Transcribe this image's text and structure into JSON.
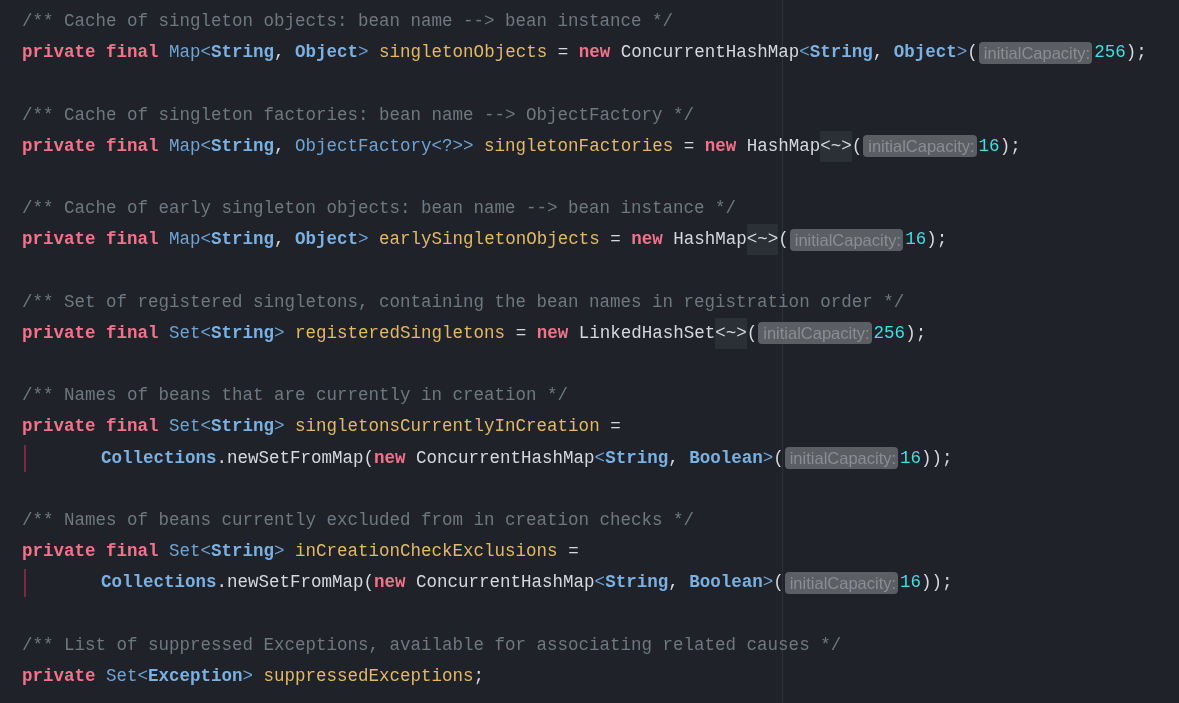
{
  "editor": {
    "lines": [
      {
        "kind": "comment",
        "text": "/** Cache of singleton objects: bean name --> bean instance */"
      },
      {
        "kind": "code",
        "continuation": false,
        "tokens": [
          {
            "kind": "keyword",
            "text": "private final "
          },
          {
            "kind": "type",
            "text": "Map<"
          },
          {
            "kind": "type_bold",
            "text": "String"
          },
          {
            "kind": "plain",
            "text": ", "
          },
          {
            "kind": "type_bold",
            "text": "Object"
          },
          {
            "kind": "type",
            "text": "> "
          },
          {
            "kind": "field",
            "text": "singletonObjects"
          },
          {
            "kind": "plain",
            "text": " = "
          },
          {
            "kind": "keyword",
            "text": "new "
          },
          {
            "kind": "plain",
            "text": "ConcurrentHashMap"
          },
          {
            "kind": "type",
            "text": "<"
          },
          {
            "kind": "type_bold",
            "text": "String"
          },
          {
            "kind": "plain",
            "text": ", "
          },
          {
            "kind": "type_bold",
            "text": "Object"
          },
          {
            "kind": "type",
            "text": ">"
          },
          {
            "kind": "plain",
            "text": "("
          },
          {
            "kind": "hint",
            "text": "initialCapacity:"
          },
          {
            "kind": "number",
            "text": "256"
          },
          {
            "kind": "plain",
            "text": ");"
          }
        ]
      },
      {
        "kind": "blank"
      },
      {
        "kind": "comment",
        "text": "/** Cache of singleton factories: bean name --> ObjectFactory */"
      },
      {
        "kind": "code",
        "continuation": false,
        "tokens": [
          {
            "kind": "keyword",
            "text": "private final "
          },
          {
            "kind": "type",
            "text": "Map<"
          },
          {
            "kind": "type_bold",
            "text": "String"
          },
          {
            "kind": "plain",
            "text": ", "
          },
          {
            "kind": "type",
            "text": "ObjectFactory<?>> "
          },
          {
            "kind": "field",
            "text": "singletonFactories"
          },
          {
            "kind": "plain",
            "text": " = "
          },
          {
            "kind": "keyword",
            "text": "new "
          },
          {
            "kind": "plain",
            "text": "HashMap"
          },
          {
            "kind": "fold",
            "text": "<~>"
          },
          {
            "kind": "plain",
            "text": "("
          },
          {
            "kind": "hint",
            "text": "initialCapacity:"
          },
          {
            "kind": "number",
            "text": "16"
          },
          {
            "kind": "plain",
            "text": ");"
          }
        ]
      },
      {
        "kind": "blank"
      },
      {
        "kind": "comment",
        "text": "/** Cache of early singleton objects: bean name --> bean instance */"
      },
      {
        "kind": "code",
        "continuation": false,
        "tokens": [
          {
            "kind": "keyword",
            "text": "private final "
          },
          {
            "kind": "type",
            "text": "Map<"
          },
          {
            "kind": "type_bold",
            "text": "String"
          },
          {
            "kind": "plain",
            "text": ", "
          },
          {
            "kind": "type_bold",
            "text": "Object"
          },
          {
            "kind": "type",
            "text": "> "
          },
          {
            "kind": "field",
            "text": "earlySingletonObjects"
          },
          {
            "kind": "plain",
            "text": " = "
          },
          {
            "kind": "keyword",
            "text": "new "
          },
          {
            "kind": "plain",
            "text": "HashMap"
          },
          {
            "kind": "fold",
            "text": "<~>"
          },
          {
            "kind": "plain",
            "text": "("
          },
          {
            "kind": "hint",
            "text": "initialCapacity:"
          },
          {
            "kind": "number",
            "text": "16"
          },
          {
            "kind": "plain",
            "text": ");"
          }
        ]
      },
      {
        "kind": "blank"
      },
      {
        "kind": "comment",
        "text": "/** Set of registered singletons, containing the bean names in registration order */"
      },
      {
        "kind": "code",
        "continuation": false,
        "tokens": [
          {
            "kind": "keyword",
            "text": "private final "
          },
          {
            "kind": "type",
            "text": "Set<"
          },
          {
            "kind": "type_bold",
            "text": "String"
          },
          {
            "kind": "type",
            "text": "> "
          },
          {
            "kind": "field",
            "text": "registeredSingletons"
          },
          {
            "kind": "plain",
            "text": " = "
          },
          {
            "kind": "keyword",
            "text": "new "
          },
          {
            "kind": "plain",
            "text": "LinkedHashSet"
          },
          {
            "kind": "fold",
            "text": "<~>"
          },
          {
            "kind": "plain",
            "text": "("
          },
          {
            "kind": "hint",
            "text": "initialCapacity:"
          },
          {
            "kind": "number",
            "text": "256"
          },
          {
            "kind": "plain",
            "text": ");"
          }
        ]
      },
      {
        "kind": "blank"
      },
      {
        "kind": "comment",
        "text": "/** Names of beans that are currently in creation */"
      },
      {
        "kind": "code",
        "continuation": false,
        "tokens": [
          {
            "kind": "keyword",
            "text": "private final "
          },
          {
            "kind": "type",
            "text": "Set<"
          },
          {
            "kind": "type_bold",
            "text": "String"
          },
          {
            "kind": "type",
            "text": "> "
          },
          {
            "kind": "field",
            "text": "singletonsCurrentlyInCreation"
          },
          {
            "kind": "plain",
            "text": " ="
          }
        ]
      },
      {
        "kind": "code",
        "continuation": true,
        "tokens": [
          {
            "kind": "type_bold",
            "text": "Collections"
          },
          {
            "kind": "plain",
            "text": ".newSetFromMap("
          },
          {
            "kind": "keyword",
            "text": "new "
          },
          {
            "kind": "plain",
            "text": "ConcurrentHashMap"
          },
          {
            "kind": "type",
            "text": "<"
          },
          {
            "kind": "type_bold",
            "text": "String"
          },
          {
            "kind": "plain",
            "text": ", "
          },
          {
            "kind": "type_bold",
            "text": "Boolean"
          },
          {
            "kind": "type",
            "text": ">"
          },
          {
            "kind": "plain",
            "text": "("
          },
          {
            "kind": "hint",
            "text": "initialCapacity:"
          },
          {
            "kind": "number",
            "text": "16"
          },
          {
            "kind": "plain",
            "text": "));"
          }
        ]
      },
      {
        "kind": "blank"
      },
      {
        "kind": "comment",
        "text": "/** Names of beans currently excluded from in creation checks */"
      },
      {
        "kind": "code",
        "continuation": false,
        "tokens": [
          {
            "kind": "keyword",
            "text": "private final "
          },
          {
            "kind": "type",
            "text": "Set<"
          },
          {
            "kind": "type_bold",
            "text": "String"
          },
          {
            "kind": "type",
            "text": "> "
          },
          {
            "kind": "field",
            "text": "inCreationCheckExclusions"
          },
          {
            "kind": "plain",
            "text": " ="
          }
        ]
      },
      {
        "kind": "code",
        "continuation": true,
        "tokens": [
          {
            "kind": "type_bold",
            "text": "Collections"
          },
          {
            "kind": "plain",
            "text": ".newSetFromMap("
          },
          {
            "kind": "keyword",
            "text": "new "
          },
          {
            "kind": "plain",
            "text": "ConcurrentHashMap"
          },
          {
            "kind": "type",
            "text": "<"
          },
          {
            "kind": "type_bold",
            "text": "String"
          },
          {
            "kind": "plain",
            "text": ", "
          },
          {
            "kind": "type_bold",
            "text": "Boolean"
          },
          {
            "kind": "type",
            "text": ">"
          },
          {
            "kind": "plain",
            "text": "("
          },
          {
            "kind": "hint",
            "text": "initialCapacity:"
          },
          {
            "kind": "number",
            "text": "16"
          },
          {
            "kind": "plain",
            "text": "));"
          }
        ]
      },
      {
        "kind": "blank"
      },
      {
        "kind": "comment",
        "text": "/** List of suppressed Exceptions, available for associating related causes */"
      },
      {
        "kind": "code",
        "continuation": false,
        "tokens": [
          {
            "kind": "keyword",
            "text": "private "
          },
          {
            "kind": "type",
            "text": "Set<"
          },
          {
            "kind": "type_bold",
            "text": "Exception"
          },
          {
            "kind": "type",
            "text": "> "
          },
          {
            "kind": "field",
            "text": "suppressedExceptions"
          },
          {
            "kind": "plain",
            "text": ";"
          }
        ]
      }
    ]
  }
}
